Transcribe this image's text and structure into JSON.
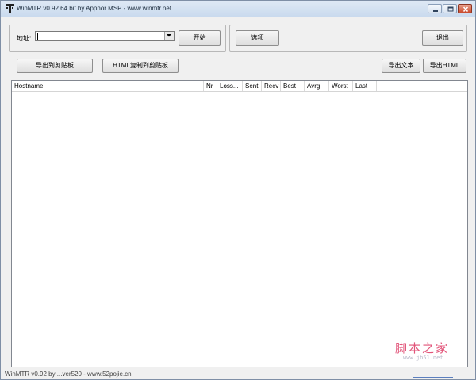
{
  "window": {
    "title": "WinMTR v0.92 64 bit by Appnor MSP - www.winmtr.net"
  },
  "host": {
    "label": "地址:",
    "value": ""
  },
  "buttons": {
    "start": "开始",
    "options": "选项",
    "exit": "退出",
    "copy_text": "导出到剪贴板",
    "copy_html": "HTML复制到剪贴板",
    "export_text": "导出文本",
    "export_html": "导出HTML"
  },
  "table": {
    "columns": [
      "Hostname",
      "Nr",
      "Loss...",
      "Sent",
      "Recv",
      "Best",
      "Avrg",
      "Worst",
      "Last"
    ],
    "rows": []
  },
  "statusbar": {
    "text": "WinMTR v0.92 by ...ver520 - www.52pojie.cn"
  },
  "watermark": {
    "main": "脚本之家",
    "url": "www.jb51.net"
  },
  "icons": {
    "app": "winmtr-app-icon",
    "minimize": "minimize-icon",
    "maximize": "maximize-icon",
    "close": "close-icon",
    "dropdown": "chevron-down-icon"
  }
}
